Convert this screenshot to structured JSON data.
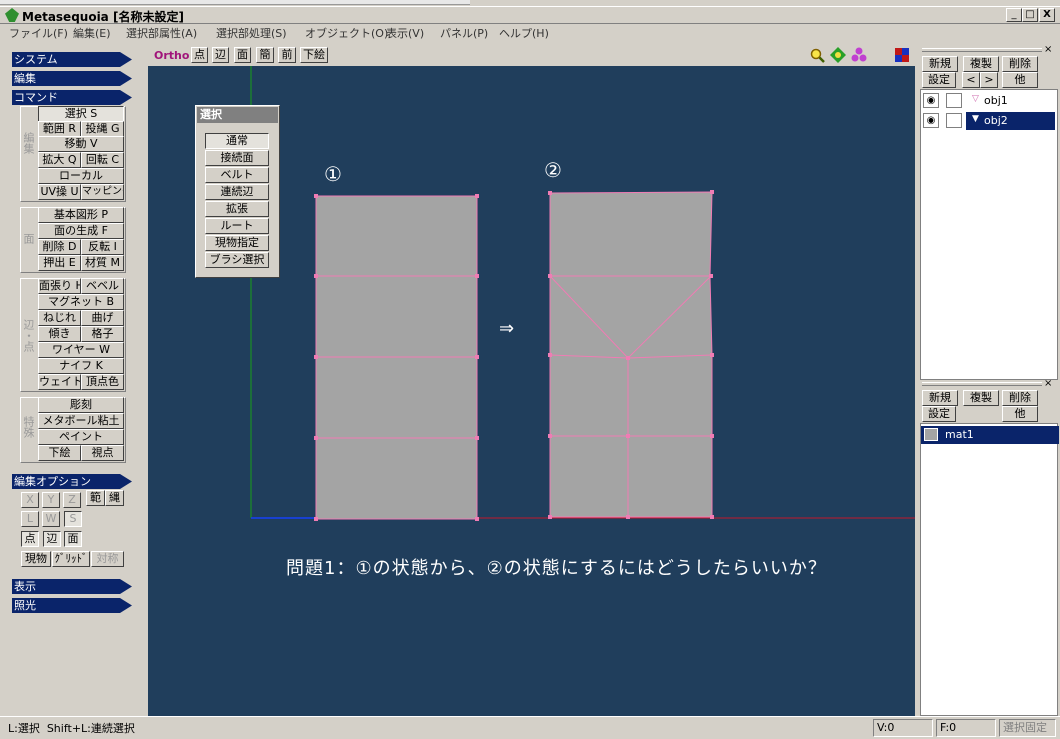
{
  "app": {
    "title": "Metasequoia [名称未設定]"
  },
  "window_buttons": {
    "minimize": "_",
    "maximize": "□",
    "close": "X"
  },
  "menu": [
    "ファイル(F)",
    "編集(E)",
    "選択部属性(A)",
    "選択部処理(S)",
    "オブジェクト(O)",
    "表示(V)",
    "パネル(P)",
    "ヘルプ(H)"
  ],
  "left": {
    "sections": {
      "system": "システム",
      "edit": "編集",
      "command": "コマンド",
      "edit_option": "編集オプション",
      "display": "表示",
      "lighting": "照光"
    },
    "group_labels": {
      "g1": "編集",
      "g2": "面",
      "g3": "辺・点",
      "g4": "特殊"
    },
    "cmd": {
      "select": "選択 S",
      "range": "範囲 R",
      "lasso": "投縄 G",
      "move": "移動 V",
      "scale": "拡大 Q",
      "rotate": "回転 C",
      "local": "ローカル",
      "uv": "UV操 U",
      "mapping": "マッピング",
      "basic_shape": "基本図形 P",
      "face_gen": "面の生成 F",
      "delete": "削除 D",
      "invert": "反転 I",
      "extrude": "押出 E",
      "material": "材質 M",
      "face_fill": "面張り H",
      "bevel": "ベベル",
      "magnet": "マグネット B",
      "twist": "ねじれ",
      "bend": "曲げ",
      "slope": "傾き",
      "lattice": "格子",
      "wire": "ワイヤー W",
      "knife": "ナイフ K",
      "weight": "ウェイト",
      "vertex_color": "頂点色",
      "sculpt": "彫刻",
      "metaball": "メタボール粘土",
      "paint": "ペイント",
      "underlay": "下絵",
      "viewpoint": "視点"
    },
    "opt": {
      "x": "X",
      "y": "Y",
      "z": "Z",
      "range": "範",
      "lasso": "縄",
      "l": "L",
      "w": "W",
      "s": "S",
      "point": "点",
      "edge": "辺",
      "face": "面",
      "current": "現物",
      "grid": "ｸﾞﾘｯﾄﾞ",
      "symmetry": "対称"
    }
  },
  "viewport": {
    "toolbar": {
      "ortho": "Ortho",
      "point": "点",
      "edge": "辺",
      "face": "面",
      "simple": "簡",
      "front": "前",
      "underlay": "下絵"
    },
    "select_panel": {
      "title": "選択",
      "items": [
        "通常",
        "接続面",
        "ベルト",
        "連続辺",
        "拡張",
        "ルート",
        "現物指定",
        "ブラシ選択"
      ]
    },
    "label1": "①",
    "label2": "②",
    "arrow": "⇒",
    "question": "問題1：①の状態から、②の状態にするにはどうしたらいいか？",
    "colors": {
      "bg": "#203e5c",
      "mesh": "#a4a4a4",
      "edge": "#f07cb4",
      "axis_x": "#c0182c",
      "axis_y": "#18a018",
      "axis_z": "#1840d0"
    }
  },
  "objects": {
    "buttons": {
      "new": "新規",
      "dup": "複製",
      "del": "削除",
      "settings": "設定",
      "prev": "<",
      "next": ">",
      "other": "他"
    },
    "items": [
      {
        "name": "obj1"
      },
      {
        "name": "obj2"
      }
    ]
  },
  "materials": {
    "buttons": {
      "new": "新規",
      "dup": "複製",
      "del": "削除",
      "settings": "設定",
      "other": "他"
    },
    "items": [
      {
        "name": "mat1"
      }
    ]
  },
  "status": {
    "hint": "L:選択  Shift+L:連続選択",
    "v": "V:0",
    "f": "F:0",
    "lock": "選択固定"
  }
}
